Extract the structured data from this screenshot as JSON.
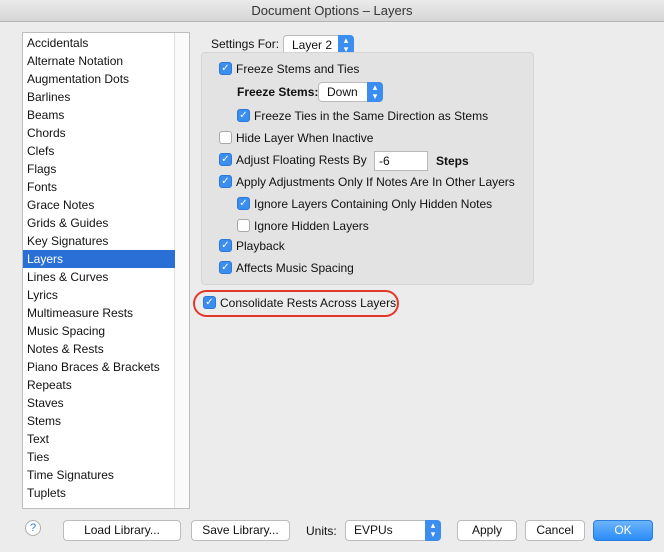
{
  "window": {
    "title": "Document Options – Layers"
  },
  "sidebar": {
    "items": [
      "Accidentals",
      "Alternate Notation",
      "Augmentation Dots",
      "Barlines",
      "Beams",
      "Chords",
      "Clefs",
      "Flags",
      "Fonts",
      "Grace Notes",
      "Grids & Guides",
      "Key Signatures",
      "Layers",
      "Lines & Curves",
      "Lyrics",
      "Multimeasure Rests",
      "Music Spacing",
      "Notes & Rests",
      "Piano Braces & Brackets",
      "Repeats",
      "Staves",
      "Stems",
      "Text",
      "Ties",
      "Time Signatures",
      "Tuplets"
    ],
    "selected": "Layers"
  },
  "settings": {
    "settings_for_label": "Settings For:",
    "layer_value": "Layer 2",
    "freeze_stems_ties": {
      "label": "Freeze Stems and Ties",
      "checked": true
    },
    "freeze_stems_label": "Freeze Stems:",
    "freeze_stems_value": "Down",
    "freeze_ties": {
      "label": "Freeze Ties in the Same Direction as Stems",
      "checked": true
    },
    "hide_layer": {
      "label": "Hide Layer When Inactive",
      "checked": false
    },
    "adjust_rests": {
      "label": "Adjust Floating Rests By",
      "checked": true
    },
    "adjust_value": "-6",
    "steps_label": "Steps",
    "apply_adj": {
      "label": "Apply Adjustments Only If Notes Are In Other Layers",
      "checked": true
    },
    "ignore_hidden_only": {
      "label": "Ignore Layers Containing Only Hidden Notes",
      "checked": true
    },
    "ignore_hidden": {
      "label": "Ignore Hidden Layers",
      "checked": false
    },
    "playback": {
      "label": "Playback",
      "checked": true
    },
    "affects_spacing": {
      "label": "Affects Music Spacing",
      "checked": true
    },
    "consolidate": {
      "label": "Consolidate Rests Across Layers",
      "checked": true
    }
  },
  "footer": {
    "help": "?",
    "load": "Load Library...",
    "save": "Save Library...",
    "units_label": "Units:",
    "units_value": "EVPUs",
    "apply": "Apply",
    "cancel": "Cancel",
    "ok": "OK"
  },
  "colors": {
    "accent": "#3b8ef0",
    "highlight": "#e0392b"
  }
}
